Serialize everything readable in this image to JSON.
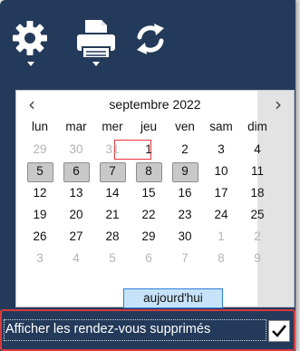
{
  "toolbar": {
    "items": [
      {
        "name": "settings",
        "icon": "gear-icon",
        "has_dropdown": true
      },
      {
        "name": "print",
        "icon": "printer-icon",
        "has_dropdown": true
      },
      {
        "name": "refresh",
        "icon": "refresh-icon",
        "has_dropdown": false
      }
    ]
  },
  "calendar": {
    "month_label": "septembre 2022",
    "prev_label": "‹",
    "next_label": "›",
    "weekdays": [
      "lun",
      "mar",
      "mer",
      "jeu",
      "ven",
      "sam",
      "dim"
    ],
    "weeks": [
      [
        {
          "d": "29",
          "muted": true
        },
        {
          "d": "30",
          "muted": true
        },
        {
          "d": "31",
          "muted": true,
          "today": true
        },
        {
          "d": "1"
        },
        {
          "d": "2"
        },
        {
          "d": "3"
        },
        {
          "d": "4"
        }
      ],
      [
        {
          "d": "5",
          "hl": true
        },
        {
          "d": "6",
          "hl": true
        },
        {
          "d": "7",
          "hl": true
        },
        {
          "d": "8",
          "hl": true
        },
        {
          "d": "9",
          "hl": true
        },
        {
          "d": "10"
        },
        {
          "d": "11"
        }
      ],
      [
        {
          "d": "12"
        },
        {
          "d": "13"
        },
        {
          "d": "14"
        },
        {
          "d": "15"
        },
        {
          "d": "16"
        },
        {
          "d": "17"
        },
        {
          "d": "18"
        }
      ],
      [
        {
          "d": "19"
        },
        {
          "d": "20"
        },
        {
          "d": "21"
        },
        {
          "d": "22"
        },
        {
          "d": "23"
        },
        {
          "d": "24"
        },
        {
          "d": "25"
        }
      ],
      [
        {
          "d": "26"
        },
        {
          "d": "27"
        },
        {
          "d": "28"
        },
        {
          "d": "29"
        },
        {
          "d": "30"
        },
        {
          "d": "1",
          "muted": true
        },
        {
          "d": "2",
          "muted": true
        }
      ],
      [
        {
          "d": "3",
          "muted": true
        },
        {
          "d": "4",
          "muted": true
        },
        {
          "d": "5",
          "muted": true
        },
        {
          "d": "6",
          "muted": true
        },
        {
          "d": "7",
          "muted": true
        },
        {
          "d": "8",
          "muted": true
        },
        {
          "d": "9",
          "muted": true
        }
      ]
    ],
    "today_button": "aujourd'hui"
  },
  "options": {
    "show_deleted_label": "Afficher les rendez-vous supprimés",
    "show_deleted_checked": true
  },
  "colors": {
    "panel_bg": "#243a5a",
    "accent_red": "#d73a3f",
    "today_button_bg": "#c6e3fa"
  }
}
